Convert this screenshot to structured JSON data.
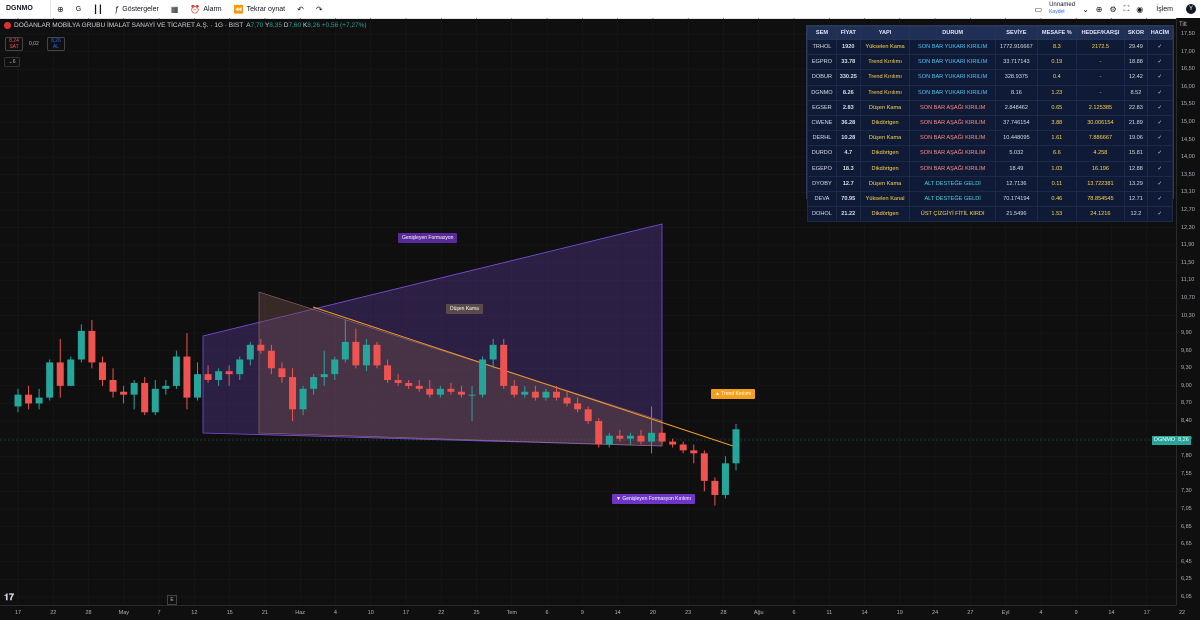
{
  "topbar": {
    "symbol": "DGNMO",
    "interval": "G",
    "indicators_label": "Göstergeler",
    "alert_label": "Alarm",
    "replay_label": "Tekrar oynat",
    "layout_name": "Unnamed",
    "layout_status": "Kaydet",
    "trade_label": "İşlem",
    "avatar_letter": "Y"
  },
  "legend": {
    "title": "DOĞANLAR MOBİLYA GRUBU İMALAT SANAYİ VE TİCARET A.Ş. · 1G · BIST",
    "ohlc": {
      "o_label": "A",
      "o": "7,70",
      "h_label": "Y",
      "h": "8,35",
      "l_label": "D",
      "l": "7,60",
      "c_label": "K",
      "c": "8,26",
      "change": "+0,56 (+7,27%)"
    },
    "sell_price": "8,24",
    "sell_label": "SAT",
    "spread": "0,02",
    "buy_price": "8,26",
    "buy_label": "AL",
    "collapse_count": "6"
  },
  "price_axis": {
    "tilt_label": "Tilt",
    "labels": [
      "17,50",
      "17,00",
      "16,50",
      "16,00",
      "15,50",
      "15,00",
      "14,50",
      "14,00",
      "13,50",
      "13,10",
      "12,70",
      "12,30",
      "11,90",
      "11,50",
      "11,10",
      "10,70",
      "10,30",
      "9,90",
      "9,60",
      "9,30",
      "9,00",
      "8,70",
      "8,40",
      "8,10",
      "7,80",
      "7,55",
      "7,30",
      "7,05",
      "6,85",
      "6,65",
      "6,45",
      "6,25",
      "6,05"
    ],
    "current_symbol": "DGNMO",
    "current_price": "8,26"
  },
  "time_axis": {
    "labels": [
      "17",
      "22",
      "28",
      "May",
      "7",
      "12",
      "15",
      "21",
      "Haz",
      "4",
      "10",
      "17",
      "22",
      "25",
      "Tem",
      "6",
      "9",
      "14",
      "20",
      "23",
      "28",
      "Ağu",
      "6",
      "11",
      "14",
      "19",
      "24",
      "27",
      "Eyl",
      "4",
      "9",
      "14",
      "17",
      "22"
    ]
  },
  "annotations": {
    "genisleyen": "Genişleyen Formasyon",
    "dusen_kama": "Düşen Kama",
    "trend_kirilimi": "▲ Trend Kırılımı",
    "genisleyen_kirilimi": "▼ Genişleyen Formasyon Kırılımı"
  },
  "scan_table": {
    "headers": [
      "SEM",
      "FİYAT",
      "YAPI",
      "DURUM",
      "SEVİYE",
      "MESAFE %",
      "HEDEF/KARŞI",
      "SKOR",
      "HACİM"
    ],
    "rows": [
      {
        "sem": "TRHOL",
        "fiyat": "1920",
        "yapi": "Yükselen Kama",
        "durum": "SON BAR YUKARI KIRILIM",
        "seviye": "1772.916667",
        "mesafe": "8.3",
        "hedef": "2172.5",
        "skor": "29.49",
        "hacim": "✓"
      },
      {
        "sem": "EGPRO",
        "fiyat": "33.78",
        "yapi": "Trend Kırılımı",
        "durum": "SON BAR YUKARI KIRILIM",
        "seviye": "33.717143",
        "mesafe": "0.19",
        "hedef": "-",
        "skor": "18.88",
        "hacim": "✓"
      },
      {
        "sem": "DOBUR",
        "fiyat": "330.25",
        "yapi": "Trend Kırılımı",
        "durum": "SON BAR YUKARI KIRILIM",
        "seviye": "328.9375",
        "mesafe": "0.4",
        "hedef": "-",
        "skor": "12.42",
        "hacim": "✓"
      },
      {
        "sem": "DGNMO",
        "fiyat": "8.26",
        "yapi": "Trend Kırılımı",
        "durum": "SON BAR YUKARI KIRILIM",
        "seviye": "8.16",
        "mesafe": "1.23",
        "hedef": "-",
        "skor": "8.52",
        "hacim": "✓"
      },
      {
        "sem": "EGSER",
        "fiyat": "2.83",
        "yapi": "Düşen Kama",
        "durum": "SON BAR AŞAĞI KIRILIM",
        "seviye": "2.848462",
        "mesafe": "0.65",
        "hedef": "2.125385",
        "skor": "22.83",
        "hacim": "✓"
      },
      {
        "sem": "CWENE",
        "fiyat": "36.28",
        "yapi": "Dikdörtgen",
        "durum": "SON BAR AŞAĞI KIRILIM",
        "seviye": "37.746154",
        "mesafe": "3.88",
        "hedef": "30.006154",
        "skor": "21.89",
        "hacim": "✓"
      },
      {
        "sem": "DERHL",
        "fiyat": "10.28",
        "yapi": "Düşen Kama",
        "durum": "SON BAR AŞAĞI KIRILIM",
        "seviye": "10.448095",
        "mesafe": "1.61",
        "hedef": "7.886667",
        "skor": "19.06",
        "hacim": "✓"
      },
      {
        "sem": "DURDO",
        "fiyat": "4.7",
        "yapi": "Dikdörtgen",
        "durum": "SON BAR AŞAĞI KIRILIM",
        "seviye": "5.032",
        "mesafe": "6.6",
        "hedef": "4.258",
        "skor": "15.81",
        "hacim": "✓"
      },
      {
        "sem": "EGEPO",
        "fiyat": "18.3",
        "yapi": "Dikdörtgen",
        "durum": "SON BAR AŞAĞI KIRILIM",
        "seviye": "18.49",
        "mesafe": "1.03",
        "hedef": "16.196",
        "skor": "12.88",
        "hacim": "✓"
      },
      {
        "sem": "DYOBY",
        "fiyat": "12.7",
        "yapi": "Düşen Kama",
        "durum": "ALT DESTEĞE GELDİ",
        "seviye": "12.7136",
        "mesafe": "0.11",
        "hedef": "13.722381",
        "skor": "13.29",
        "hacim": "✓"
      },
      {
        "sem": "DEVA",
        "fiyat": "70.95",
        "yapi": "Yükselen Kanal",
        "durum": "ALT DESTEĞE GELDİ",
        "seviye": "70.174194",
        "mesafe": "0.46",
        "hedef": "78.854545",
        "skor": "12.71",
        "hacim": "✓"
      },
      {
        "sem": "DOHOL",
        "fiyat": "21.22",
        "yapi": "Dikdörtgen",
        "durum": "ÜST ÇİZGİYİ FİTİL KIRDI",
        "seviye": "21.5496",
        "mesafe": "1.53",
        "hedef": "24.1216",
        "skor": "12.2",
        "hacim": "✓"
      }
    ]
  },
  "colors": {
    "up": "#26a69a",
    "down": "#ef5350",
    "genisleyen_fill": "#5b3a9c",
    "dusen_fill": "#6b4a4a",
    "trendline": "#f29b26",
    "yukari": "#4fc3f7",
    "asagi": "#ff8a80",
    "destek": "#4dd0e1",
    "ust": "#ffd54f",
    "yapi": "#ffd54f",
    "mesafe": "#ffd54f",
    "hedef": "#ffd54f"
  },
  "chart_data": {
    "type": "candlestick",
    "symbol": "DGNMO",
    "candles": [
      {
        "o": 8.65,
        "h": 8.95,
        "l": 8.55,
        "c": 8.85
      },
      {
        "o": 8.85,
        "h": 9.0,
        "l": 8.6,
        "c": 8.7
      },
      {
        "o": 8.7,
        "h": 8.95,
        "l": 8.6,
        "c": 8.8
      },
      {
        "o": 8.8,
        "h": 9.45,
        "l": 8.75,
        "c": 9.4
      },
      {
        "o": 9.4,
        "h": 9.8,
        "l": 8.8,
        "c": 9.0
      },
      {
        "o": 9.0,
        "h": 9.5,
        "l": 9.0,
        "c": 9.45
      },
      {
        "o": 9.45,
        "h": 10.1,
        "l": 9.4,
        "c": 9.95
      },
      {
        "o": 9.95,
        "h": 10.2,
        "l": 9.3,
        "c": 9.4
      },
      {
        "o": 9.4,
        "h": 9.5,
        "l": 9.0,
        "c": 9.1
      },
      {
        "o": 9.1,
        "h": 9.3,
        "l": 8.8,
        "c": 8.9
      },
      {
        "o": 8.9,
        "h": 9.0,
        "l": 8.7,
        "c": 8.85
      },
      {
        "o": 8.85,
        "h": 9.1,
        "l": 8.6,
        "c": 9.05
      },
      {
        "o": 9.05,
        "h": 9.15,
        "l": 8.5,
        "c": 8.55
      },
      {
        "o": 8.55,
        "h": 9.1,
        "l": 8.5,
        "c": 8.95
      },
      {
        "o": 8.95,
        "h": 9.1,
        "l": 8.85,
        "c": 9.0
      },
      {
        "o": 9.0,
        "h": 9.6,
        "l": 8.95,
        "c": 9.5
      },
      {
        "o": 9.5,
        "h": 9.9,
        "l": 8.6,
        "c": 8.8
      },
      {
        "o": 8.8,
        "h": 9.4,
        "l": 8.75,
        "c": 9.2
      },
      {
        "o": 9.2,
        "h": 9.35,
        "l": 9.05,
        "c": 9.1
      },
      {
        "o": 9.1,
        "h": 9.3,
        "l": 9.0,
        "c": 9.25
      },
      {
        "o": 9.25,
        "h": 9.35,
        "l": 9.0,
        "c": 9.2
      },
      {
        "o": 9.2,
        "h": 9.5,
        "l": 9.1,
        "c": 9.45
      },
      {
        "o": 9.45,
        "h": 9.75,
        "l": 9.35,
        "c": 9.7
      },
      {
        "o": 9.7,
        "h": 9.8,
        "l": 9.55,
        "c": 9.6
      },
      {
        "o": 9.6,
        "h": 9.7,
        "l": 9.2,
        "c": 9.3
      },
      {
        "o": 9.3,
        "h": 9.4,
        "l": 9.05,
        "c": 9.15
      },
      {
        "o": 9.15,
        "h": 9.3,
        "l": 8.4,
        "c": 8.6
      },
      {
        "o": 8.6,
        "h": 9.0,
        "l": 8.5,
        "c": 8.95
      },
      {
        "o": 8.95,
        "h": 9.2,
        "l": 8.85,
        "c": 9.15
      },
      {
        "o": 9.15,
        "h": 9.6,
        "l": 9.0,
        "c": 9.2
      },
      {
        "o": 9.2,
        "h": 9.5,
        "l": 9.1,
        "c": 9.45
      },
      {
        "o": 9.45,
        "h": 10.2,
        "l": 9.4,
        "c": 9.75
      },
      {
        "o": 9.75,
        "h": 10.0,
        "l": 9.3,
        "c": 9.35
      },
      {
        "o": 9.35,
        "h": 9.8,
        "l": 9.25,
        "c": 9.7
      },
      {
        "o": 9.7,
        "h": 9.75,
        "l": 9.3,
        "c": 9.35
      },
      {
        "o": 9.35,
        "h": 9.45,
        "l": 9.05,
        "c": 9.1
      },
      {
        "o": 9.1,
        "h": 9.2,
        "l": 9.0,
        "c": 9.05
      },
      {
        "o": 9.05,
        "h": 9.1,
        "l": 8.95,
        "c": 9.0
      },
      {
        "o": 9.0,
        "h": 9.1,
        "l": 8.9,
        "c": 8.95
      },
      {
        "o": 8.95,
        "h": 9.1,
        "l": 8.8,
        "c": 8.85
      },
      {
        "o": 8.85,
        "h": 9.0,
        "l": 8.8,
        "c": 8.95
      },
      {
        "o": 8.95,
        "h": 9.05,
        "l": 8.85,
        "c": 8.9
      },
      {
        "o": 8.9,
        "h": 9.0,
        "l": 8.8,
        "c": 8.85
      },
      {
        "o": 8.85,
        "h": 9.0,
        "l": 8.4,
        "c": 8.85
      },
      {
        "o": 8.85,
        "h": 9.5,
        "l": 8.8,
        "c": 9.45
      },
      {
        "o": 9.45,
        "h": 9.8,
        "l": 9.3,
        "c": 9.7
      },
      {
        "o": 9.7,
        "h": 9.8,
        "l": 8.95,
        "c": 9.0
      },
      {
        "o": 9.0,
        "h": 9.1,
        "l": 8.8,
        "c": 8.85
      },
      {
        "o": 8.85,
        "h": 9.0,
        "l": 8.8,
        "c": 8.9
      },
      {
        "o": 8.9,
        "h": 9.0,
        "l": 8.75,
        "c": 8.8
      },
      {
        "o": 8.8,
        "h": 8.95,
        "l": 8.75,
        "c": 8.9
      },
      {
        "o": 8.9,
        "h": 9.0,
        "l": 8.75,
        "c": 8.8
      },
      {
        "o": 8.8,
        "h": 8.9,
        "l": 8.65,
        "c": 8.7
      },
      {
        "o": 8.7,
        "h": 8.8,
        "l": 8.55,
        "c": 8.6
      },
      {
        "o": 8.6,
        "h": 8.65,
        "l": 8.35,
        "c": 8.4
      },
      {
        "o": 8.4,
        "h": 8.45,
        "l": 7.95,
        "c": 8.0
      },
      {
        "o": 8.0,
        "h": 8.2,
        "l": 7.95,
        "c": 8.15
      },
      {
        "o": 8.15,
        "h": 8.25,
        "l": 8.05,
        "c": 8.1
      },
      {
        "o": 8.1,
        "h": 8.2,
        "l": 8.0,
        "c": 8.15
      },
      {
        "o": 8.15,
        "h": 8.25,
        "l": 8.0,
        "c": 8.05
      },
      {
        "o": 8.05,
        "h": 8.65,
        "l": 7.85,
        "c": 8.2
      },
      {
        "o": 8.2,
        "h": 8.3,
        "l": 8.0,
        "c": 8.05
      },
      {
        "o": 8.05,
        "h": 8.1,
        "l": 7.95,
        "c": 8.0
      },
      {
        "o": 8.0,
        "h": 8.05,
        "l": 7.85,
        "c": 7.9
      },
      {
        "o": 7.9,
        "h": 8.0,
        "l": 7.7,
        "c": 7.85
      },
      {
        "o": 7.85,
        "h": 7.9,
        "l": 7.3,
        "c": 7.45
      },
      {
        "o": 7.45,
        "h": 7.5,
        "l": 7.1,
        "c": 7.25
      },
      {
        "o": 7.25,
        "h": 7.8,
        "l": 7.2,
        "c": 7.7
      },
      {
        "o": 7.7,
        "h": 8.35,
        "l": 7.6,
        "c": 8.26
      }
    ]
  }
}
